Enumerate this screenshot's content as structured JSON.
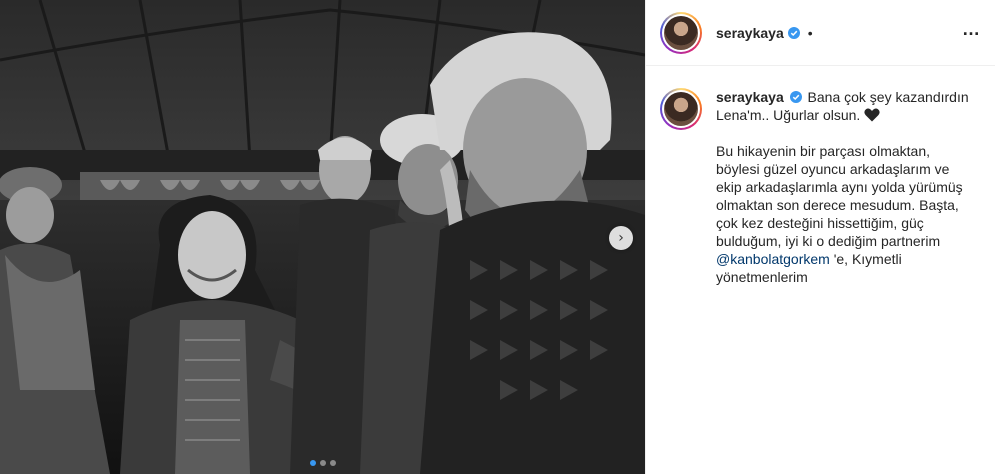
{
  "post": {
    "username": "seraykaya",
    "header_separator": "•",
    "more_label": "…",
    "verified_icon": "verified-badge-icon",
    "colors": {
      "verified": "#3897f0",
      "mention": "#00376b",
      "active_dot": "#3897f0"
    },
    "carousel": {
      "total_images": 3,
      "current_index": 1
    },
    "caption": {
      "line1": "Bana çok şey kazandırdın Lena'm.. Uğurlar olsun.",
      "heart_icon": "black-heart-icon",
      "para2_before": "Bu hikayenin bir parçası olmaktan, böylesi güzel oyuncu arkadaşlarım ve ekip arkadaşlarımla aynı yolda yürümüş olmaktan son derece mesudum. Başta, çok kez desteğini hissettiğim, güç bulduğum, iyi ki o dediğim partnerim",
      "mention": "@kanbolatgorkem",
      "para2_after": "'e, Kıymetli yönetmenlerim"
    }
  }
}
